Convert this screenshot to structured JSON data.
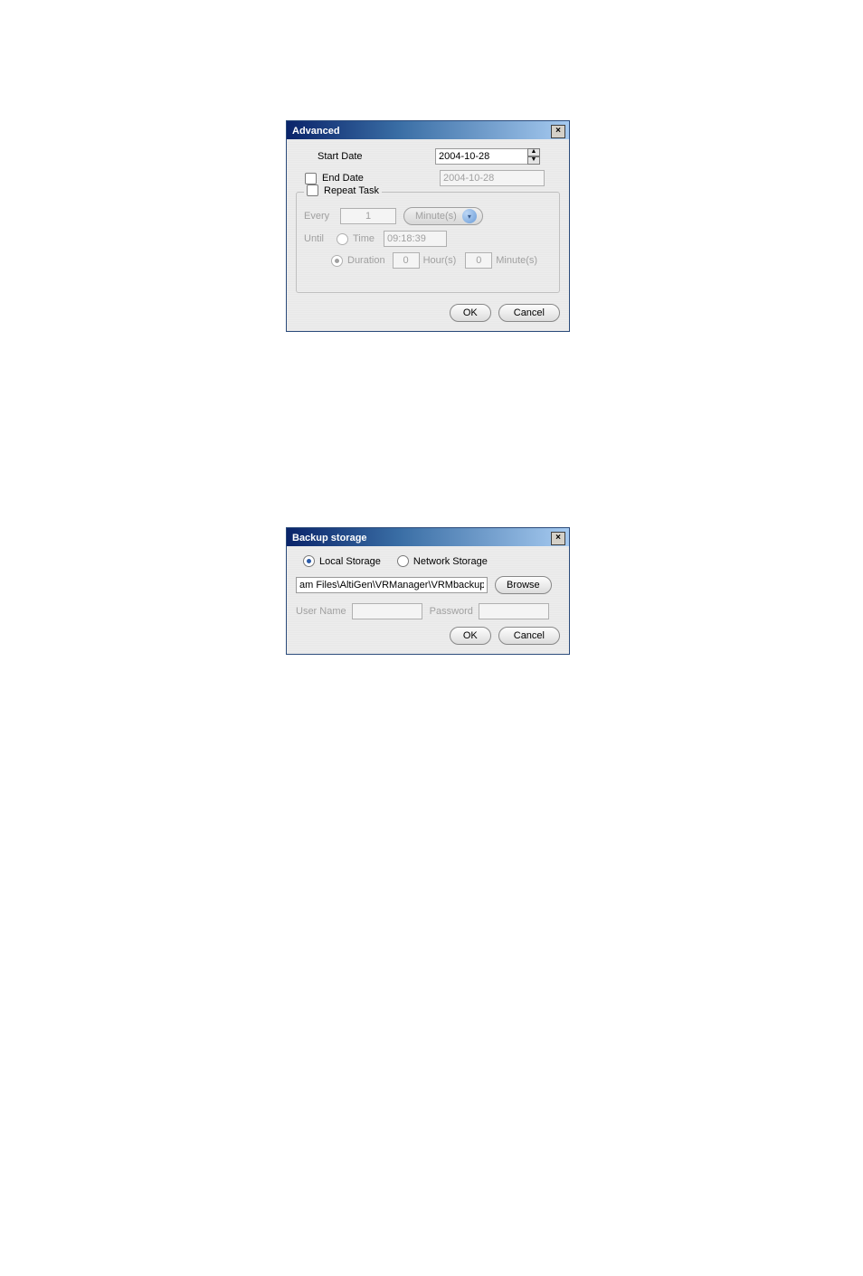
{
  "advanced": {
    "title": "Advanced",
    "start_date_label": "Start Date",
    "start_date_value": "2004-10-28",
    "end_date_label": "End Date",
    "end_date_value": "2004-10-28",
    "repeat_legend": "Repeat Task",
    "every_label": "Every",
    "every_value": "1",
    "unit_label": "Minute(s)",
    "until_label": "Until",
    "time_label": "Time",
    "time_value": "09:18:39",
    "duration_label": "Duration",
    "duration_hours": "0",
    "hours_label": "Hour(s)",
    "duration_minutes": "0",
    "minutes_label": "Minute(s)",
    "ok": "OK",
    "cancel": "Cancel"
  },
  "backup": {
    "title": "Backup storage",
    "local_label": "Local Storage",
    "network_label": "Network Storage",
    "path_value": "am Files\\AltiGen\\VRManager\\VRMbackup",
    "browse": "Browse",
    "user_label": "User Name",
    "password_label": "Password",
    "ok": "OK",
    "cancel": "Cancel"
  }
}
